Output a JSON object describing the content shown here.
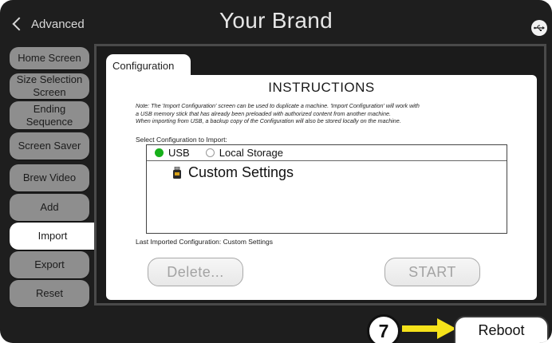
{
  "header": {
    "back_label": "Advanced",
    "title": "Your Brand",
    "usb_icon": "usb-icon"
  },
  "sidebar": {
    "items": [
      {
        "label": "Home Screen"
      },
      {
        "label": "Size Selection Screen"
      },
      {
        "label": "Ending Sequence"
      },
      {
        "label": "Screen Saver"
      },
      {
        "label": "Brew Video"
      },
      {
        "label": "Add"
      },
      {
        "label": "Import",
        "active": true
      },
      {
        "label": "Export"
      },
      {
        "label": "Reset"
      }
    ]
  },
  "main": {
    "tab_label": "Configuration",
    "instructions_title": "INSTRUCTIONS",
    "note_line1": "Note: The 'Import Configuration' screen can be used to duplicate a machine. 'Import Configuration' will work with",
    "note_line2": "a USB memory stick that has already been preloaded with authorized content from another machine.",
    "note_line3": "When importing from USB, a backup copy of the Configuration will also be stored locally on the machine.",
    "select_label": "Select Configuration to Import:",
    "source_options": [
      {
        "label": "USB",
        "selected": true
      },
      {
        "label": "Local Storage",
        "selected": false
      }
    ],
    "items": [
      {
        "label": "Custom Settings",
        "icon": "usb-stick-icon"
      }
    ],
    "last_imported": "Last Imported Configuration: Custom Settings",
    "delete_label": "Delete...",
    "start_label": "START"
  },
  "footer": {
    "step_number": "7",
    "reboot_label": "Reboot"
  },
  "colors": {
    "selected_radio": "#17b01a",
    "callout_arrow": "#f5e21a",
    "sidebar_button": "#8e8e8e"
  }
}
